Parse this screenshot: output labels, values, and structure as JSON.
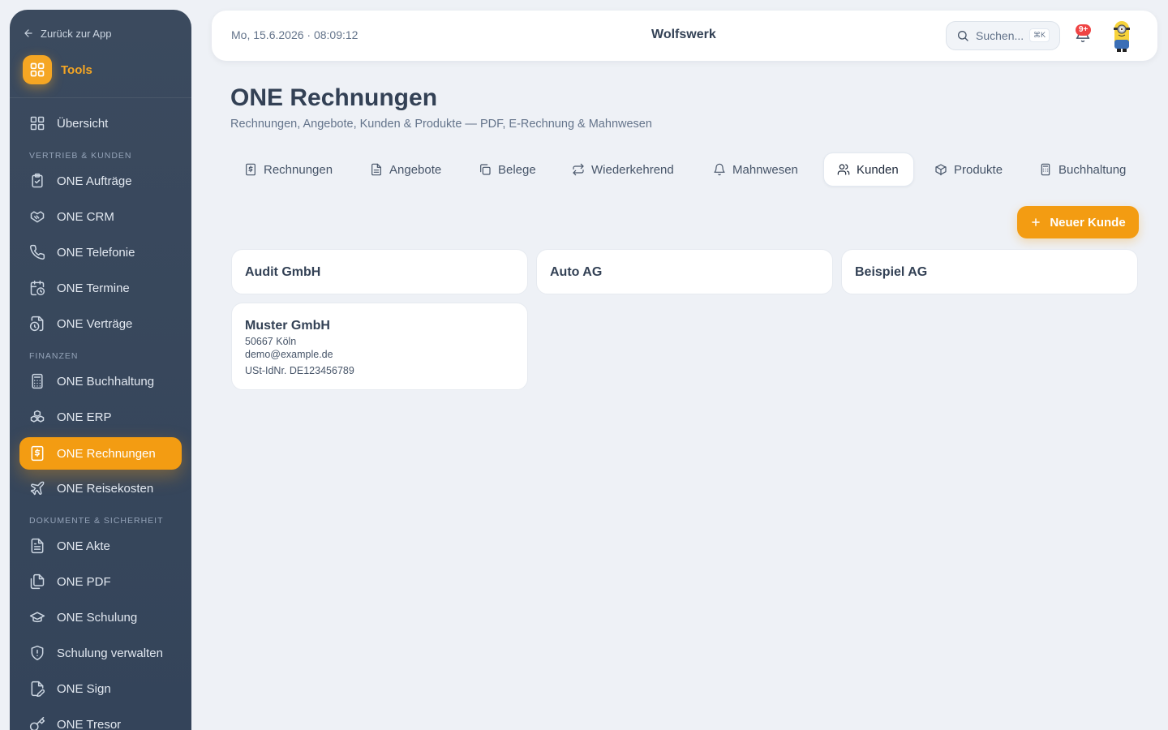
{
  "sidebar": {
    "back_label": "Zurück zur App",
    "tools_label": "Tools",
    "sections": {
      "vertrieb": "VERTRIEB & KUNDEN",
      "finanzen": "FINANZEN",
      "dokumente": "DOKUMENTE & SICHERHEIT"
    },
    "items": {
      "uebersicht": "Übersicht",
      "auftraege": "ONE Aufträge",
      "crm": "ONE CRM",
      "telefonie": "ONE Telefonie",
      "termine": "ONE Termine",
      "vertraege": "ONE Verträge",
      "buchhaltung": "ONE Buchhaltung",
      "erp": "ONE ERP",
      "rechnungen": "ONE Rechnungen",
      "reisekosten": "ONE Reisekosten",
      "akte": "ONE Akte",
      "pdf": "ONE PDF",
      "schulung": "ONE Schulung",
      "schulung_verwalten": "Schulung verwalten",
      "sign": "ONE Sign",
      "tresor": "ONE Tresor"
    }
  },
  "topbar": {
    "datetime": "Mo, 15.6.2026 · 08:09:12",
    "brand": "Wolfswerk",
    "search_placeholder": "Suchen...",
    "search_shortcut": "⌘K",
    "notifications_badge": "9+"
  },
  "main": {
    "title": "ONE Rechnungen",
    "subtitle": "Rechnungen, Angebote, Kunden & Produkte — PDF, E-Rechnung & Mahnwesen",
    "tabs": {
      "rechnungen": "Rechnungen",
      "angebote": "Angebote",
      "belege": "Belege",
      "wiederkehrend": "Wiederkehrend",
      "mahnwesen": "Mahnwesen",
      "kunden": "Kunden",
      "produkte": "Produkte",
      "buchhaltung": "Buchhaltung"
    },
    "active_tab": "Kunden",
    "new_button": "Neuer Kunde",
    "customers": [
      {
        "name": "Audit GmbH"
      },
      {
        "name": "Auto AG"
      },
      {
        "name": "Beispiel AG"
      },
      {
        "name": "Muster GmbH",
        "city": "50667 Köln",
        "email": "demo@example.de",
        "vat": "USt-IdNr. DE123456789"
      }
    ]
  },
  "colors": {
    "accent": "#f39c12",
    "sidebar_bg": "#3b4a5e",
    "page_bg": "#eef1f6",
    "badge": "#ef4444"
  }
}
